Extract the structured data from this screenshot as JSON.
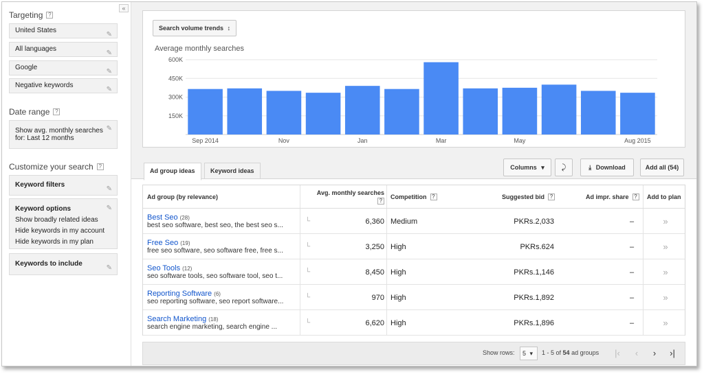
{
  "sidebar": {
    "collapse_glyph": "«",
    "targeting_title": "Targeting",
    "targeting_items": [
      "United States",
      "All languages",
      "Google",
      "Negative keywords"
    ],
    "date_range_title": "Date range",
    "date_range_line1": "Show avg. monthly searches",
    "date_range_line2": "for: Last 12 months",
    "customize_title": "Customize your search",
    "keyword_filters": "Keyword filters",
    "keyword_options_title": "Keyword options",
    "keyword_options": [
      "Show broadly related ideas",
      "Hide keywords in my account",
      "Hide keywords in my plan"
    ],
    "keywords_to_include": "Keywords to include",
    "help_glyph": "?"
  },
  "chart_panel": {
    "trend_button": "Search volume trends",
    "trend_arrow": "↕"
  },
  "chart_data": {
    "type": "bar",
    "title": "Average monthly searches",
    "categories": [
      "Sep 2014",
      "Oct",
      "Nov",
      "Dec",
      "Jan",
      "Feb",
      "Mar",
      "Apr",
      "May",
      "Jun",
      "Jul",
      "Aug 2015"
    ],
    "x_tick_labels": [
      "Sep 2014",
      "",
      "Nov",
      "",
      "Jan",
      "",
      "Mar",
      "",
      "May",
      "",
      "",
      "Aug 2015"
    ],
    "values": [
      365000,
      370000,
      350000,
      335000,
      390000,
      365000,
      580000,
      370000,
      375000,
      400000,
      350000,
      335000
    ],
    "ylim": [
      0,
      600000
    ],
    "yticks": [
      150000,
      300000,
      450000,
      600000
    ],
    "ytick_labels": [
      "150K",
      "300K",
      "450K",
      "600K"
    ],
    "bar_color": "#4a8af4",
    "grid": true
  },
  "tabs": [
    "Ad group ideas",
    "Keyword ideas"
  ],
  "toolbar": {
    "columns": "Columns",
    "columns_caret": "▾",
    "chart_icon": "⤸",
    "download": "Download",
    "download_icon": "⤓",
    "add_all": "Add all (54)"
  },
  "table": {
    "headers": {
      "ad_group": "Ad group (by relevance)",
      "avg_searches": "Avg. monthly searches",
      "competition": "Competition",
      "suggested_bid": "Suggested bid",
      "ad_impr_share": "Ad impr. share",
      "add_to_plan": "Add to plan"
    },
    "rows": [
      {
        "name": "Best Seo",
        "count": "(28)",
        "keywords": "best seo software, best seo, the best seo s...",
        "searches": "6,360",
        "competition": "Medium",
        "bid": "PKRs.2,033",
        "share": "–",
        "add": "»"
      },
      {
        "name": "Free Seo",
        "count": "(19)",
        "keywords": "free seo software, seo software free, free s...",
        "searches": "3,250",
        "competition": "High",
        "bid": "PKRs.624",
        "share": "–",
        "add": "»"
      },
      {
        "name": "Seo Tools",
        "count": "(12)",
        "keywords": "seo software tools, seo software tool, seo t...",
        "searches": "8,450",
        "competition": "High",
        "bid": "PKRs.1,146",
        "share": "–",
        "add": "»"
      },
      {
        "name": "Reporting Software",
        "count": "(6)",
        "keywords": "seo reporting software, seo report software...",
        "searches": "970",
        "competition": "High",
        "bid": "PKRs.1,892",
        "share": "–",
        "add": "»"
      },
      {
        "name": "Search Marketing",
        "count": "(18)",
        "keywords": "search engine marketing, search engine ...",
        "searches": "6,620",
        "competition": "High",
        "bid": "PKRs.1,896",
        "share": "–",
        "add": "»"
      }
    ],
    "trend_glyph": "└"
  },
  "pager": {
    "show_rows": "Show rows:",
    "rows_value": "5",
    "rows_caret": "▾",
    "range": "1 - 5 of",
    "total": "54",
    "suffix": "ad groups",
    "first": "|‹",
    "prev": "‹",
    "next": "›",
    "last": "›|"
  }
}
